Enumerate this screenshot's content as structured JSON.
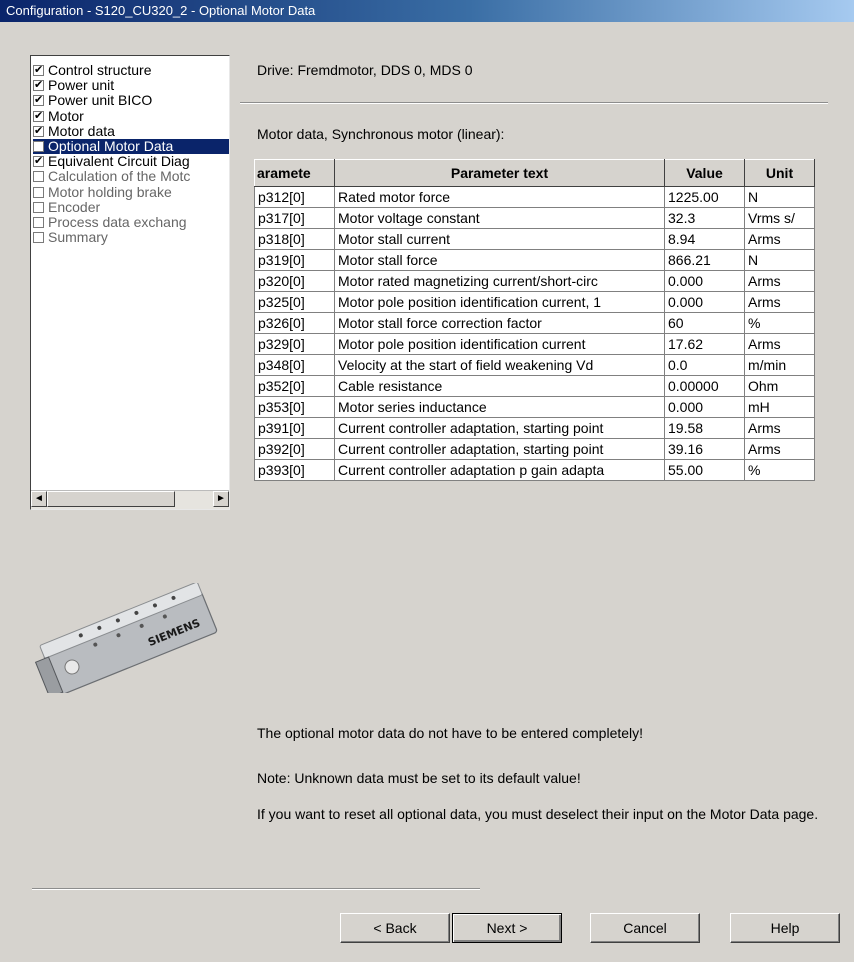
{
  "window": {
    "title": "Configuration - S120_CU320_2 - Optional Motor Data"
  },
  "nav": {
    "items": [
      {
        "label": "Control structure",
        "checked": true,
        "selected": false
      },
      {
        "label": "Power unit",
        "checked": true,
        "selected": false
      },
      {
        "label": "Power unit BICO",
        "checked": true,
        "selected": false
      },
      {
        "label": "Motor",
        "checked": true,
        "selected": false
      },
      {
        "label": "Motor data",
        "checked": true,
        "selected": false
      },
      {
        "label": "Optional Motor Data",
        "checked": false,
        "selected": true
      },
      {
        "label": "Equivalent Circuit Diag",
        "checked": true,
        "selected": false
      },
      {
        "label": "Calculation of the Motc",
        "checked": false,
        "selected": false
      },
      {
        "label": "Motor holding brake",
        "checked": false,
        "selected": false
      },
      {
        "label": "Encoder",
        "checked": false,
        "selected": false
      },
      {
        "label": "Process data exchang",
        "checked": false,
        "selected": false
      },
      {
        "label": "Summary",
        "checked": false,
        "selected": false
      }
    ],
    "scroll_left_icon": "◄",
    "scroll_right_icon": "►"
  },
  "main": {
    "drive": "Drive: Fremdmotor, DDS 0, MDS 0",
    "motor_data_label": "Motor data, Synchronous motor (linear):",
    "table": {
      "headers": [
        "aramete",
        "Parameter text",
        "Value",
        "Unit"
      ],
      "rows": [
        [
          "p312[0]",
          "Rated motor force",
          "1225.00",
          "N"
        ],
        [
          "p317[0]",
          "Motor voltage constant",
          "32.3",
          "Vrms s/"
        ],
        [
          "p318[0]",
          "Motor stall current",
          "8.94",
          "Arms"
        ],
        [
          "p319[0]",
          "Motor stall force",
          "866.21",
          "N"
        ],
        [
          "p320[0]",
          "Motor rated magnetizing current/short-circ",
          "0.000",
          "Arms"
        ],
        [
          "p325[0]",
          "Motor pole position identification current, 1",
          "0.000",
          "Arms"
        ],
        [
          "p326[0]",
          "Motor stall force correction factor",
          "60",
          "%"
        ],
        [
          "p329[0]",
          "Motor pole position identification current",
          "17.62",
          "Arms"
        ],
        [
          "p348[0]",
          "Velocity at the start of field weakening Vd",
          "0.0",
          "m/min"
        ],
        [
          "p352[0]",
          "Cable resistance",
          "0.00000",
          "Ohm"
        ],
        [
          "p353[0]",
          "Motor series inductance",
          "0.000",
          "mH"
        ],
        [
          "p391[0]",
          "Current controller adaptation, starting point",
          "19.58",
          "Arms"
        ],
        [
          "p392[0]",
          "Current controller adaptation, starting point",
          "39.16",
          "Arms"
        ],
        [
          "p393[0]",
          "Current controller adaptation p gain adapta",
          "55.00",
          "%"
        ]
      ]
    },
    "device_brand": "SIEMENS",
    "info_line1": "The optional motor data do not have to be entered completely!",
    "info_line2": "Note: Unknown data must be set to its default value!",
    "info_line3": "If you want to reset all optional data, you must deselect their input on the Motor Data page."
  },
  "buttons": {
    "back": "< Back",
    "next": "Next >",
    "cancel": "Cancel",
    "help": "Help"
  }
}
